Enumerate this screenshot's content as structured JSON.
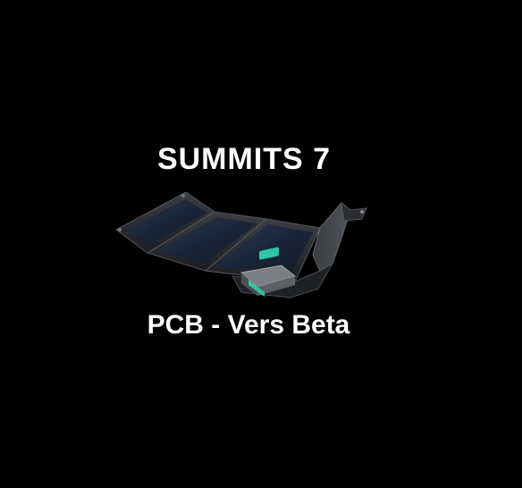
{
  "title": "SUMMITS 7",
  "subtitle": "PCB - Vers Beta",
  "colors": {
    "background": "#000000",
    "text": "#ffffff",
    "accent": "#2ec4a6"
  },
  "image": {
    "subject": "folding-solar-panel-charger"
  }
}
